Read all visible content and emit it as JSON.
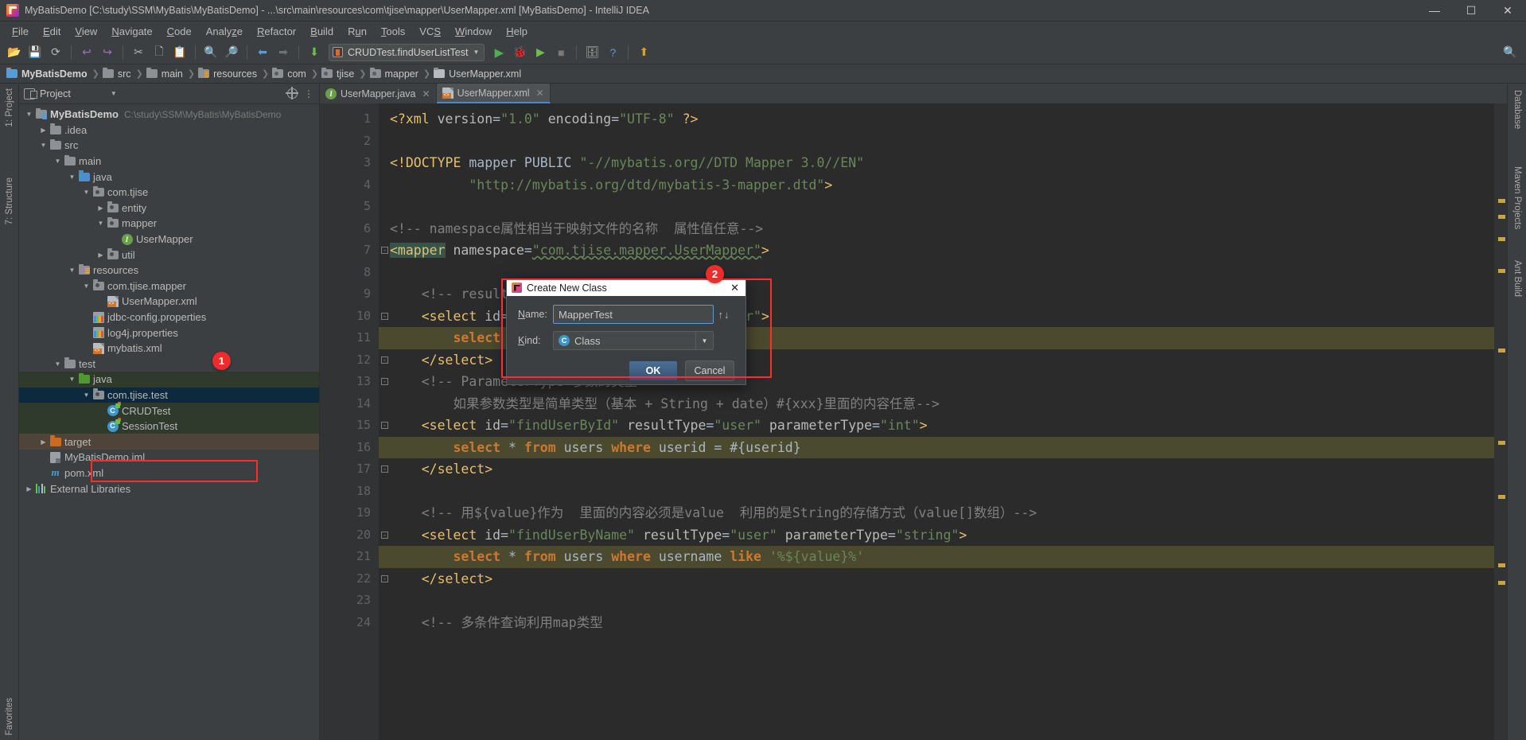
{
  "window": {
    "title": "MyBatisDemo [C:\\study\\SSM\\MyBatis\\MyBatisDemo] - ...\\src\\main\\resources\\com\\tjise\\mapper\\UserMapper.xml [MyBatisDemo] - IntelliJ IDEA",
    "minimize": "—",
    "maximize": "☐",
    "close": "✕",
    "app_icon": "intellij-idea-icon"
  },
  "menubar": [
    {
      "label": "File",
      "mnemonic": "F"
    },
    {
      "label": "Edit",
      "mnemonic": "E"
    },
    {
      "label": "View",
      "mnemonic": "V"
    },
    {
      "label": "Navigate",
      "mnemonic": "N"
    },
    {
      "label": "Code",
      "mnemonic": "C"
    },
    {
      "label": "Analyze",
      "mnemonic": "z"
    },
    {
      "label": "Refactor",
      "mnemonic": "R"
    },
    {
      "label": "Build",
      "mnemonic": "B"
    },
    {
      "label": "Run",
      "mnemonic": "u"
    },
    {
      "label": "Tools",
      "mnemonic": "T"
    },
    {
      "label": "VCS",
      "mnemonic": "S"
    },
    {
      "label": "Window",
      "mnemonic": "W"
    },
    {
      "label": "Help",
      "mnemonic": "H"
    }
  ],
  "toolbar": {
    "run_config": "CRUDTest.findUserListTest",
    "icons": [
      "open-folder-icon",
      "save-icon",
      "sync-icon",
      "undo-icon",
      "redo-icon",
      "cut-icon",
      "copy-icon",
      "paste-icon",
      "find-icon",
      "replace-icon",
      "back-icon",
      "forward-icon",
      "compile-icon"
    ],
    "right_icons": [
      "run-icon",
      "debug-icon",
      "run-coverage-icon",
      "stop-icon",
      "profile-icon",
      "help-icon",
      "update-icon",
      "search-everywhere-icon"
    ]
  },
  "breadcrumb": [
    {
      "label": "MyBatisDemo",
      "icon": "module-icon"
    },
    {
      "label": "src",
      "icon": "folder-icon"
    },
    {
      "label": "main",
      "icon": "folder-icon"
    },
    {
      "label": "resources",
      "icon": "resources-folder-icon"
    },
    {
      "label": "com",
      "icon": "package-icon"
    },
    {
      "label": "tjise",
      "icon": "package-icon"
    },
    {
      "label": "mapper",
      "icon": "package-icon"
    },
    {
      "label": "UserMapper.xml",
      "icon": "xml-file-icon"
    }
  ],
  "left_strip": {
    "project_label": "1: Project",
    "structure_label": "7: Structure",
    "favorites_label": "Favorites"
  },
  "right_strip": [
    {
      "label": "Database"
    },
    {
      "label": "Maven Projects"
    },
    {
      "label": "Ant Build"
    }
  ],
  "project_panel": {
    "title": "Project",
    "tree": [
      {
        "depth": 0,
        "twisty": "▼",
        "icon": "module-icon",
        "label": "MyBatisDemo",
        "bold": true,
        "path": "C:\\study\\SSM\\MyBatis\\MyBatisDemo",
        "state": ""
      },
      {
        "depth": 1,
        "twisty": "▶",
        "icon": "folder-icon",
        "label": ".idea",
        "bold": false,
        "path": "",
        "state": ""
      },
      {
        "depth": 1,
        "twisty": "▼",
        "icon": "folder-icon",
        "label": "src",
        "bold": false,
        "path": "",
        "state": ""
      },
      {
        "depth": 2,
        "twisty": "▼",
        "icon": "folder-icon",
        "label": "main",
        "bold": false,
        "path": "",
        "state": ""
      },
      {
        "depth": 3,
        "twisty": "▼",
        "icon": "source-folder-icon",
        "label": "java",
        "bold": false,
        "path": "",
        "state": ""
      },
      {
        "depth": 4,
        "twisty": "▼",
        "icon": "package-icon",
        "label": "com.tjise",
        "bold": false,
        "path": "",
        "state": ""
      },
      {
        "depth": 5,
        "twisty": "▶",
        "icon": "package-icon",
        "label": "entity",
        "bold": false,
        "path": "",
        "state": ""
      },
      {
        "depth": 5,
        "twisty": "▼",
        "icon": "package-icon",
        "label": "mapper",
        "bold": false,
        "path": "",
        "state": ""
      },
      {
        "depth": 6,
        "twisty": "",
        "icon": "interface-icon",
        "label": "UserMapper",
        "bold": false,
        "path": "",
        "state": ""
      },
      {
        "depth": 5,
        "twisty": "▶",
        "icon": "package-icon",
        "label": "util",
        "bold": false,
        "path": "",
        "state": ""
      },
      {
        "depth": 3,
        "twisty": "▼",
        "icon": "resources-folder-icon",
        "label": "resources",
        "bold": false,
        "path": "",
        "state": ""
      },
      {
        "depth": 4,
        "twisty": "▼",
        "icon": "package-icon",
        "label": "com.tjise.mapper",
        "bold": false,
        "path": "",
        "state": ""
      },
      {
        "depth": 5,
        "twisty": "",
        "icon": "xml-file-icon",
        "label": "UserMapper.xml",
        "bold": false,
        "path": "",
        "state": ""
      },
      {
        "depth": 4,
        "twisty": "",
        "icon": "properties-file-icon",
        "label": "jdbc-config.properties",
        "bold": false,
        "path": "",
        "state": ""
      },
      {
        "depth": 4,
        "twisty": "",
        "icon": "properties-file-icon",
        "label": "log4j.properties",
        "bold": false,
        "path": "",
        "state": ""
      },
      {
        "depth": 4,
        "twisty": "",
        "icon": "xml-file-icon",
        "label": "mybatis.xml",
        "bold": false,
        "path": "",
        "state": ""
      },
      {
        "depth": 2,
        "twisty": "▼",
        "icon": "folder-icon",
        "label": "test",
        "bold": false,
        "path": "",
        "state": ""
      },
      {
        "depth": 3,
        "twisty": "▼",
        "icon": "test-source-folder-icon",
        "label": "java",
        "bold": false,
        "path": "",
        "state": "sel-green"
      },
      {
        "depth": 4,
        "twisty": "▼",
        "icon": "package-icon",
        "label": "com.tjise.test",
        "bold": false,
        "path": "",
        "state": "sel-blue"
      },
      {
        "depth": 5,
        "twisty": "",
        "icon": "test-class-icon",
        "label": "CRUDTest",
        "bold": false,
        "path": "",
        "state": "sel-green"
      },
      {
        "depth": 5,
        "twisty": "",
        "icon": "test-class-icon",
        "label": "SessionTest",
        "bold": false,
        "path": "",
        "state": "sel-green"
      },
      {
        "depth": 1,
        "twisty": "▶",
        "icon": "target-folder-icon",
        "label": "target",
        "bold": false,
        "path": "",
        "state": "sel-gray"
      },
      {
        "depth": 1,
        "twisty": "",
        "icon": "iml-file-icon",
        "label": "MyBatisDemo.iml",
        "bold": false,
        "path": "",
        "state": ""
      },
      {
        "depth": 1,
        "twisty": "",
        "icon": "maven-file-icon",
        "label": "pom.xml",
        "bold": false,
        "path": "",
        "state": ""
      },
      {
        "depth": 0,
        "twisty": "▶",
        "icon": "library-icon",
        "label": "External Libraries",
        "bold": false,
        "path": "",
        "state": ""
      }
    ]
  },
  "editor": {
    "tabs": [
      {
        "label": "UserMapper.java",
        "icon": "interface-icon",
        "active": false,
        "close": "✕"
      },
      {
        "label": "UserMapper.xml",
        "icon": "xml-file-icon",
        "active": true,
        "close": "✕"
      }
    ],
    "lines": [
      {
        "n": 1,
        "hl": "",
        "fold": "",
        "html": "<span class='k-tag'>&lt;?xml</span> <span class='k-attr'>version</span>=<span class='k-str'>\"1.0\"</span> <span class='k-attr'>encoding</span>=<span class='k-str'>\"UTF-8\"</span> <span class='k-tag'>?&gt;</span>"
      },
      {
        "n": 2,
        "hl": "",
        "fold": "",
        "html": ""
      },
      {
        "n": 3,
        "hl": "",
        "fold": "",
        "html": "<span class='k-tag'>&lt;!DOCTYPE</span> <span class='k-txt'>mapper</span> <span class='k-txt'>PUBLIC</span> <span class='k-str'>\"-//mybatis.org//DTD Mapper 3.0//EN\"</span>"
      },
      {
        "n": 4,
        "hl": "",
        "fold": "",
        "html": "          <span class='k-str'>\"http://mybatis.org/dtd/mybatis-3-mapper.dtd\"</span><span class='k-tag'>&gt;</span>"
      },
      {
        "n": 5,
        "hl": "",
        "fold": "",
        "html": ""
      },
      {
        "n": 6,
        "hl": "",
        "fold": "",
        "html": "<span class='k-cmt'>&lt;!-- namespace属性相当于映射文件的名称  属性值任意--&gt;</span>"
      },
      {
        "n": 7,
        "hl": "",
        "fold": "-",
        "html": "<span class='k-mapper-hl'>&lt;mapper</span> <span class='k-attr'>namespace</span>=<span class='k-str squig'>\"com.tjise.mapper.UserMapper\"</span><span class='k-tag'>&gt;</span>"
      },
      {
        "n": 8,
        "hl": "",
        "fold": "",
        "html": ""
      },
      {
        "n": 9,
        "hl": "",
        "fold": "",
        "html": "    <span class='k-cmt'>&lt;!-- resultType是返回的类型 --&gt;</span>"
      },
      {
        "n": 10,
        "hl": "",
        "fold": "-",
        "html": "    <span class='k-tag'>&lt;select</span> <span class='k-attr'>id</span>=<span class='k-str'>\"findUserList\"</span> <span class='k-attr'>resultType</span>=<span class='k-str'>\"user\"</span><span class='k-tag'>&gt;</span>"
      },
      {
        "n": 11,
        "hl": "hl",
        "fold": "",
        "html": "        <span class='k-sql'>select</span> <span class='k-txt'>*</span> <span class='k-sql'>from</span> <span class='k-txt'>users</span>"
      },
      {
        "n": 12,
        "hl": "",
        "fold": "-",
        "html": "    <span class='k-tag'>&lt;/select&gt;</span>"
      },
      {
        "n": 13,
        "hl": "",
        "fold": "-",
        "html": "    <span class='k-cmt'>&lt;!-- ParameterType 参数的类型</span>"
      },
      {
        "n": 14,
        "hl": "",
        "fold": "",
        "html": "        <span class='k-cmt'>如果参数类型是简单类型（基本 + String + date）#{xxx}里面的内容任意--&gt;</span>"
      },
      {
        "n": 15,
        "hl": "",
        "fold": "-",
        "html": "    <span class='k-tag'>&lt;select</span> <span class='k-attr'>id</span>=<span class='k-str'>\"findUserById\"</span> <span class='k-attr'>resultType</span>=<span class='k-str'>\"user\"</span> <span class='k-attr'>parameterType</span>=<span class='k-str'>\"int\"</span><span class='k-tag'>&gt;</span>"
      },
      {
        "n": 16,
        "hl": "hl",
        "fold": "",
        "html": "        <span class='k-sql'>select</span> <span class='k-txt'>*</span> <span class='k-sql'>from</span> <span class='k-txt'>users</span> <span class='k-sql'>where</span> <span class='k-txt'>userid = #{userid}</span>"
      },
      {
        "n": 17,
        "hl": "",
        "fold": "-",
        "html": "    <span class='k-tag'>&lt;/select&gt;</span>"
      },
      {
        "n": 18,
        "hl": "",
        "fold": "",
        "html": ""
      },
      {
        "n": 19,
        "hl": "",
        "fold": "",
        "html": "    <span class='k-cmt'>&lt;!-- 用${value}作为  里面的内容必须是value  利用的是String的存储方式（value[]数组）--&gt;</span>"
      },
      {
        "n": 20,
        "hl": "",
        "fold": "-",
        "html": "    <span class='k-tag'>&lt;select</span> <span class='k-attr'>id</span>=<span class='k-str'>\"findUserByName\"</span> <span class='k-attr'>resultType</span>=<span class='k-str'>\"user\"</span> <span class='k-attr'>parameterType</span>=<span class='k-str'>\"string\"</span><span class='k-tag'>&gt;</span>"
      },
      {
        "n": 21,
        "hl": "hl",
        "fold": "",
        "html": "        <span class='k-sql'>select</span> <span class='k-txt'>*</span> <span class='k-sql'>from</span> <span class='k-txt'>users</span> <span class='k-sql'>where</span> <span class='k-txt'>username</span> <span class='k-sql'>like</span> <span class='k-str'>'%${value}%'</span>"
      },
      {
        "n": 22,
        "hl": "",
        "fold": "-",
        "html": "    <span class='k-tag'>&lt;/select&gt;</span>"
      },
      {
        "n": 23,
        "hl": "",
        "fold": "",
        "html": ""
      },
      {
        "n": 24,
        "hl": "",
        "fold": "",
        "html": "    <span class='k-cmt'>&lt;!-- 多条件查询利用map类型</span>"
      }
    ]
  },
  "dialog": {
    "title": "Create New Class",
    "close": "✕",
    "name_label": "Name:",
    "name_mnemonic": "N",
    "name_value": "MapperTest",
    "updown_icon": "↑↓",
    "kind_label": "Kind:",
    "kind_mnemonic": "K",
    "kind_value": "Class",
    "kind_badge": "C",
    "dropdown_arrow": "▼",
    "ok": "OK",
    "cancel": "Cancel"
  },
  "annotations": [
    {
      "id": "1",
      "label": "1"
    },
    {
      "id": "2",
      "label": "2"
    }
  ]
}
